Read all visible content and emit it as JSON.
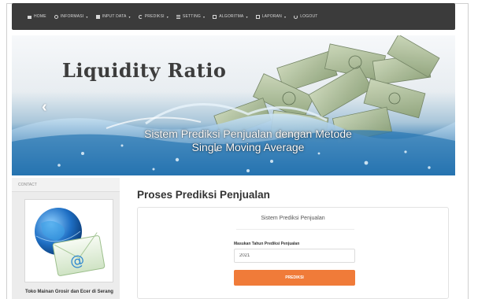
{
  "nav": {
    "items": [
      {
        "label": "HOME",
        "icon": "home-icon",
        "dropdown": false
      },
      {
        "label": "INFORMASI",
        "icon": "info-icon",
        "dropdown": true
      },
      {
        "label": "INPUT DATA",
        "icon": "document-icon",
        "dropdown": true
      },
      {
        "label": "PREDIKSI",
        "icon": "refresh-icon",
        "dropdown": true
      },
      {
        "label": "SETTING",
        "icon": "bars-icon",
        "dropdown": true
      },
      {
        "label": "ALGORITMA",
        "icon": "grid-icon",
        "dropdown": true
      },
      {
        "label": "LAPORAN",
        "icon": "grid-icon",
        "dropdown": true
      },
      {
        "label": "LOGOUT",
        "icon": "power-icon",
        "dropdown": false
      }
    ],
    "caret": "▾"
  },
  "banner": {
    "title": "Liquidity Ratio",
    "caption": "Sistem Prediksi Penjualan dengan Metode Single Moving Average",
    "prev_glyph": "‹"
  },
  "sidebar": {
    "heading": "CONTACT",
    "shop_text": "Toko Mainan Grosir dan Ecer di Serang"
  },
  "main": {
    "page_title": "Proses Prediksi Penjualan",
    "panel_title": "Sistem Prediksi Penjualan",
    "field_label": "Masukan Tahun Prediksi Penjualan",
    "year_value": "2021",
    "button_label": "PREDIKSI"
  },
  "colors": {
    "navbar": "#3b3b3b",
    "accent": "#f07b39"
  }
}
